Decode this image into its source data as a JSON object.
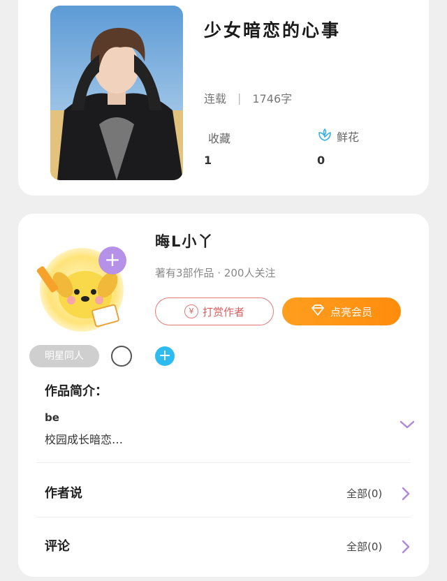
{
  "book": {
    "title": "少女暗恋的心事",
    "status": "连载",
    "word_count": "1746字",
    "favorites_label": "收藏",
    "favorites_count": "1",
    "flowers_label": "鲜花",
    "flowers_count": "0"
  },
  "author": {
    "name": "晦L小丫",
    "meta": "著有3部作品 · 200人关注",
    "tip_button": "打赏作者",
    "tip_symbol": "¥",
    "vip_button": "点亮会员",
    "tag": "明星同人"
  },
  "intro": {
    "title": "作品简介：",
    "line1": "be",
    "line2": "校园成长暗恋…"
  },
  "sections": [
    {
      "title": "作者说",
      "link": "全部(0)"
    },
    {
      "title": "评论",
      "link": "全部(0)"
    }
  ],
  "colors": {
    "accent_orange": "#ff9e1f",
    "accent_purple": "#b691e8",
    "tip_red": "#e47a7a",
    "add_blue": "#2ebcf0"
  }
}
